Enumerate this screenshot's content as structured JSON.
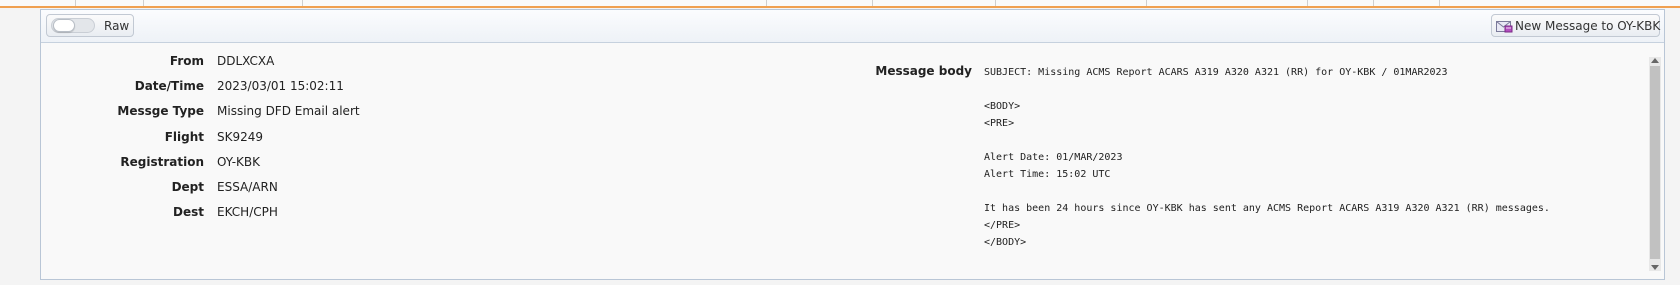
{
  "toolbar": {
    "raw_label": "Raw",
    "raw_on": false,
    "new_message_label": "New Message to OY-KBK"
  },
  "fields": [
    {
      "label": "From",
      "value": "DDLXCXA"
    },
    {
      "label": "Date/Time",
      "value": "2023/03/01 15:02:11"
    },
    {
      "label": "Messge Type",
      "value": "Missing DFD Email alert"
    },
    {
      "label": "Flight",
      "value": "SK9249"
    },
    {
      "label": "Registration",
      "value": "OY-KBK"
    },
    {
      "label": "Dept",
      "value": "ESSA/ARN"
    },
    {
      "label": "Dest",
      "value": "EKCH/CPH"
    }
  ],
  "message": {
    "label": "Message body",
    "body": "SUBJECT: Missing ACMS Report ACARS A319 A320 A321 (RR) for OY-KBK / 01MAR2023\n\n<BODY>\n<PRE>\n\nAlert Date: 01/MAR/2023\nAlert Time: 15:02 UTC\n\nIt has been 24 hours since OY-KBK has sent any ACMS Report ACARS A319 A320 A321 (RR) messages.\n</PRE>\n</BODY>"
  },
  "icons": {
    "new_message": "envelope-icon"
  }
}
